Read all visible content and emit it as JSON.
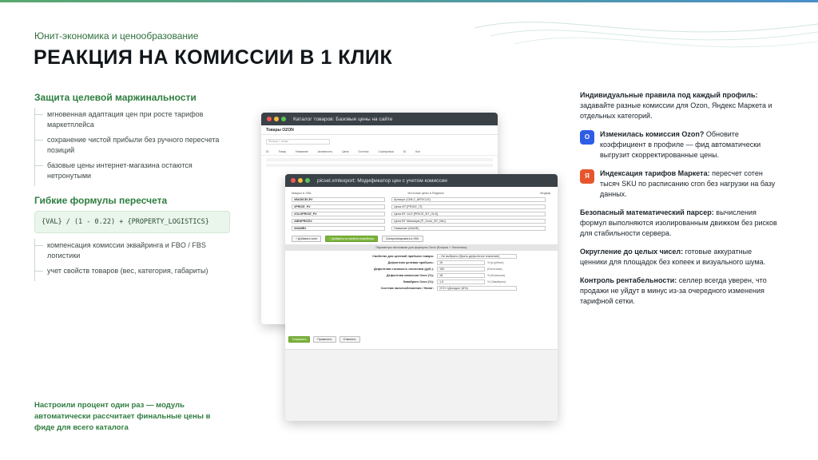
{
  "eyebrow": "Юнит-экономика и ценообразование",
  "title": "РЕАКЦИЯ НА КОМИССИИ В 1 КЛИК",
  "left": {
    "section1_title": "Защита целевой маржинальности",
    "section1_items": [
      "мгновенная адаптация цен при росте тарифов маркетплейса",
      "сохранение чистой прибыли без ручного пересчета позиций",
      "базовые цены интернет-магазина остаются нетронутыми"
    ],
    "section2_title": "Гибкие формулы пересчета",
    "formula": "{VAL} / (1 - 0.22) + {PROPERTY_LOGISTICS}",
    "section2_items": [
      "компенсация комиссии эквайринга и FBO / FBS логистики",
      "учет свойств товаров (вес, категория, габариты)"
    ],
    "footnote": "Настроили процент один раз — модуль автоматически рассчитает финальные цены в фиде для всего каталога"
  },
  "window1": {
    "title": "Каталог товаров: Базовые цены на сайте",
    "tab": "Товары OZON",
    "search_placeholder": "Фильтр + поиск",
    "columns": [
      "ID",
      "Товар",
      "Название",
      "Активность",
      "Цена",
      "Остаток",
      "Сортировка",
      "ID",
      "Кол"
    ]
  },
  "window2": {
    "title": "picsel.xmlexport: Модификатор цен с учетом комиссии",
    "col_macro": "Макрос в XML",
    "col_source": "Источник цены в Яндексе",
    "col_mod": "Модиф.",
    "rows": [
      {
        "macro": "#BASICELP#",
        "source": "Артикул (CML2_ARTICLE)"
      },
      {
        "macro": "#PRICE_P#",
        "source": "Цена ИТ [PRICE_IT]"
      },
      {
        "macro": "#OLDPRICE_P#",
        "source": "Цена ВТ OLD [PRICE_BT_OLD]"
      },
      {
        "macro": "#MINPRICE#",
        "source": "Цена ВТ Минимум [P_Ozon_BT_Min]"
      },
      {
        "macro": "#NAME#",
        "source": "Название (NAME)"
      }
    ],
    "buttons": [
      "+ Добавить поле",
      "+ Добавить из свойств инфоблока",
      "Синхронизировать в XML"
    ],
    "band": "Параметры экономики для формулы Ozon (Бонусы + Логистика)",
    "params": [
      {
        "label": "Свойство для целевой прибыли товара:",
        "value": "- Не выбрано (брать дефолтное значение)",
        "note": ""
      },
      {
        "label": "Дефолтная целевая прибыль:",
        "value": "15",
        "note": "% (в рублях)"
      },
      {
        "label": "Дефолтная стоимость логистики (руб.):",
        "value": "150",
        "note": "(Логистика)"
      },
      {
        "label": "Дефолтная комиссия Ozon (%):",
        "value": "18",
        "note": "% (Комиссия)"
      },
      {
        "label": "Эквайринг Ozon (%):",
        "value": "1.5",
        "note": "% (Эквайринг)"
      },
      {
        "label": "Система налогообложения / Налог:",
        "value": "УСН «Доходы» (6%)",
        "note": ""
      }
    ],
    "footer_buttons": [
      "Сохранить",
      "Применить",
      "Отменить"
    ]
  },
  "right": {
    "p1_bold": "Индивидуальные правила под каждый профиль:",
    "p1_text": " задавайте разные комиссии для Ozon, Яндекс Маркета и отдельных категорий.",
    "item1_icon": "О",
    "item1_bold": "Изменилась комиссия Ozon?",
    "item1_text": " Обновите коэффициент в профиле — фид автоматически выгрузит скорректированные цены.",
    "item2_icon": "Я",
    "item2_bold": "Индексация тарифов Маркета:",
    "item2_text": " пересчет сотен тысяч SKU по расписанию cron без нагрузки на базу данных.",
    "p2_bold": "Безопасный математический парсер:",
    "p2_text": " вычисления формул выполняются изолированным движком без рисков для стабильности сервера.",
    "p3_bold": "Округление до целых чисел:",
    "p3_text": " готовые аккуратные ценники для площадок без копеек и визуального шума.",
    "p4_bold": "Контроль рентабельности:",
    "p4_text": " селлер всегда уверен, что продажи не уйдут в минус из-за очередного изменения тарифной сетки."
  },
  "colors": {
    "accent_green": "#2e7d3f",
    "ozon_blue": "#2e5ce6",
    "market_orange": "#e7552d"
  }
}
